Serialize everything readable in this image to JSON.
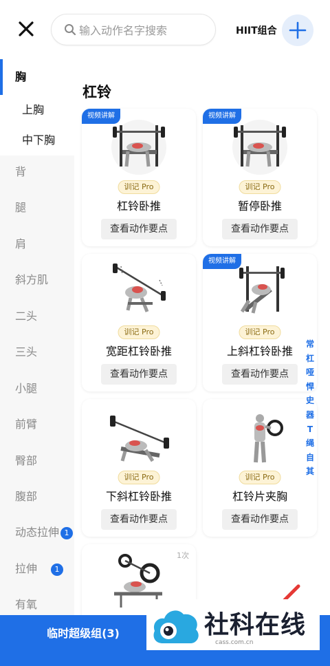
{
  "topbar": {
    "search_placeholder": "输入动作名字搜索",
    "hiit_label": "HIIT组合"
  },
  "sidebar": {
    "items": [
      {
        "label": "胸"
      },
      {
        "label": "上胸"
      },
      {
        "label": "中下胸"
      },
      {
        "label": "背"
      },
      {
        "label": "腿"
      },
      {
        "label": "肩"
      },
      {
        "label": "斜方肌"
      },
      {
        "label": "二头"
      },
      {
        "label": "三头"
      },
      {
        "label": "小腿"
      },
      {
        "label": "前臂"
      },
      {
        "label": "臀部"
      },
      {
        "label": "腹部"
      },
      {
        "label": "动态拉伸",
        "badge": "1"
      },
      {
        "label": "拉伸",
        "badge": "1"
      },
      {
        "label": "有氧"
      }
    ]
  },
  "main": {
    "section_title": "杠铃",
    "video_tag": "视频讲解",
    "pro_tag": "训记 Pro",
    "key_points_label": "查看动作要点",
    "exercises": [
      {
        "name": "杠铃卧推"
      },
      {
        "name": "暂停卧推"
      },
      {
        "name": "宽距杠铃卧推"
      },
      {
        "name": "上斜杠铃卧推"
      },
      {
        "name": "下斜杠铃卧推"
      },
      {
        "name": "杠铃片夹胸"
      }
    ],
    "partial_card_count": "1次"
  },
  "index_letters": [
    "常",
    "杠",
    "哑",
    "悍",
    "史",
    "器",
    "T",
    "绳",
    "自",
    "其"
  ],
  "bottom_bar": {
    "label": "临时超级组(3)"
  },
  "watermark": {
    "text": "社科在线",
    "url": "cass.com.cn"
  },
  "colors": {
    "accent": "#1f6fe6",
    "pro_bg": "#fdf3d6"
  },
  "icons": [
    "close-icon",
    "search-icon",
    "plus-icon"
  ]
}
